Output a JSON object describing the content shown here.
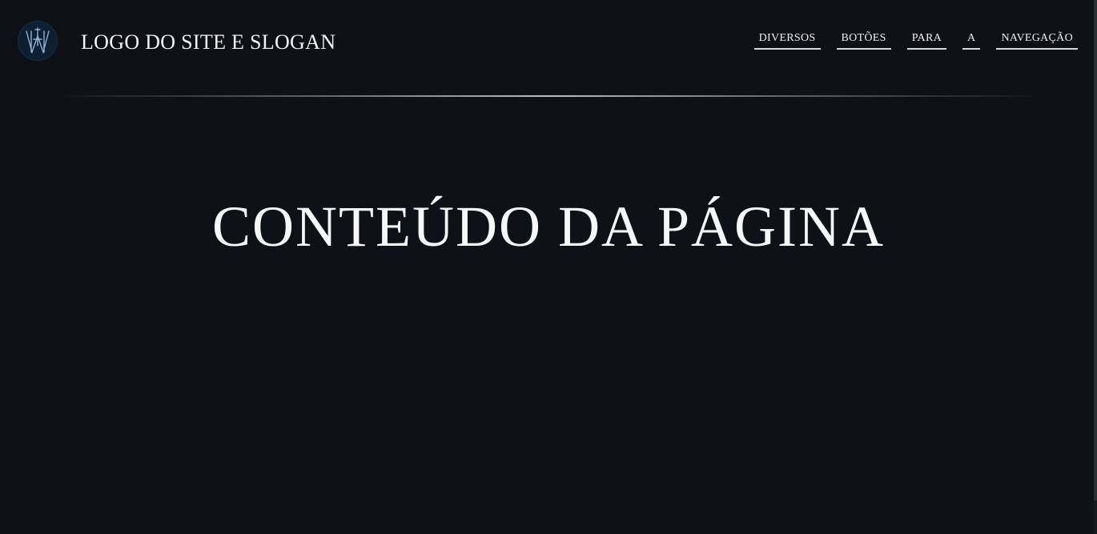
{
  "header": {
    "logo": {
      "icon": "monogram-logo-icon",
      "color": "#8fb0d0"
    },
    "title": "LOGO DO SITE E SLOGAN"
  },
  "nav": {
    "items": [
      {
        "label": "DIVERSOS"
      },
      {
        "label": "BOTÕES"
      },
      {
        "label": "PARA"
      },
      {
        "label": "A"
      },
      {
        "label": "NAVEGAÇÃO"
      }
    ]
  },
  "main": {
    "heading": "CONTEÚDO DA PÁGINA"
  },
  "colors": {
    "background": "#0e1116",
    "text": "#f2f2f2",
    "logo_background": "#0f1f32",
    "nav_underline": "#d9d9d9"
  }
}
